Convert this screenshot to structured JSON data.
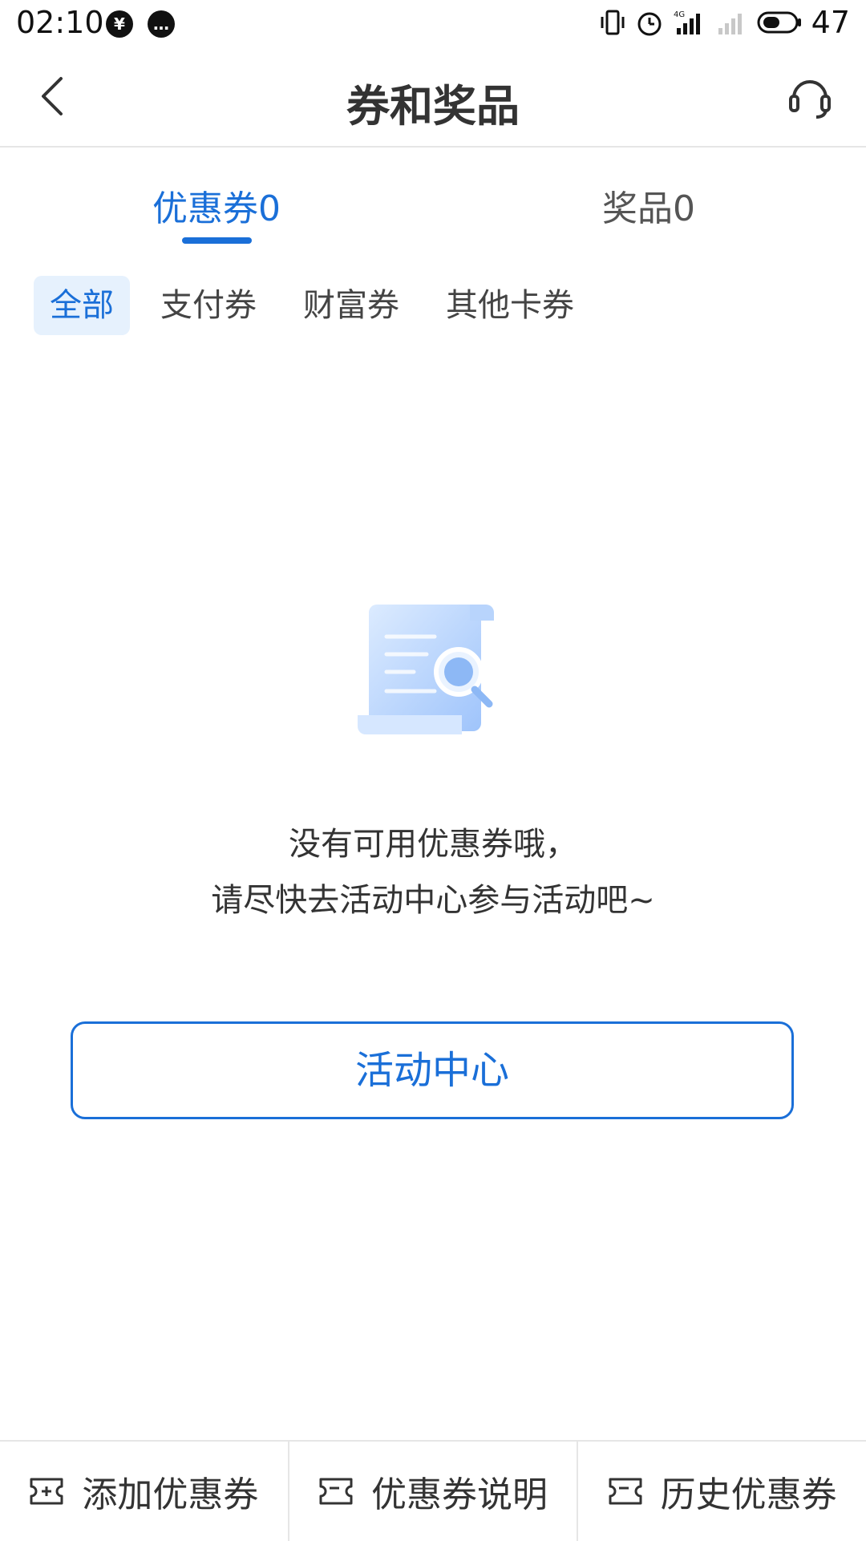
{
  "status_bar": {
    "time": "02:10",
    "battery": "47",
    "icons": [
      "yen-shield-icon",
      "message-icon",
      "vibrate-icon",
      "alarm-icon",
      "signal-4g-icon",
      "signal-icon",
      "battery-icon"
    ]
  },
  "header": {
    "title": "券和奖品",
    "back_icon": "chevron-left-icon",
    "support_icon": "headset-icon"
  },
  "main_tabs": [
    {
      "label": "优惠券0",
      "active": true
    },
    {
      "label": "奖品0",
      "active": false
    }
  ],
  "filters": [
    {
      "label": "全部",
      "active": true
    },
    {
      "label": "支付券",
      "active": false
    },
    {
      "label": "财富券",
      "active": false
    },
    {
      "label": "其他卡券",
      "active": false
    }
  ],
  "empty_state": {
    "line1": "没有可用优惠券哦，",
    "line2": "请尽快去活动中心参与活动吧~",
    "button": "活动中心"
  },
  "bottom_bar": [
    {
      "label": "添加优惠券",
      "icon": "ticket-add-icon"
    },
    {
      "label": "优惠券说明",
      "icon": "ticket-icon"
    },
    {
      "label": "历史优惠券",
      "icon": "ticket-icon"
    }
  ],
  "colors": {
    "accent": "#1a6fd8",
    "chip_bg": "#e6f1fd",
    "text": "#333333",
    "divider": "#e6e6e6"
  }
}
